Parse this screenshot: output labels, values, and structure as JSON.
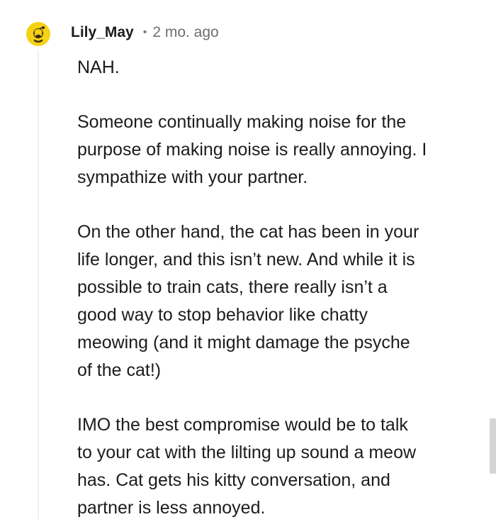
{
  "comment": {
    "author": "Lily_May",
    "separator": "•",
    "timestamp": "2 mo. ago",
    "avatar_icon": "snoo-avatar-icon",
    "avatar_color": "#f5d213",
    "paragraphs": [
      "NAH.",
      "Someone continually making noise for the\npurpose of making noise is really annoying. I\nsympathize with your partner.",
      "On the other hand, the cat has been in your\nlife longer, and this isn’t new. And while it is\npossible to train cats, there really isn’t a\ngood way to stop behavior like chatty\nmeowing (and it might damage the psyche\nof the cat!)",
      "IMO the best compromise would be to talk\nto your cat with the lilting up sound a meow\nhas. Cat gets his kitty conversation, and\npartner is less annoyed."
    ]
  },
  "colors": {
    "text": "#1c1c1c",
    "muted": "#6f6f6f",
    "thread_line": "#edeff1",
    "scrollbar": "#d4d4d4"
  }
}
